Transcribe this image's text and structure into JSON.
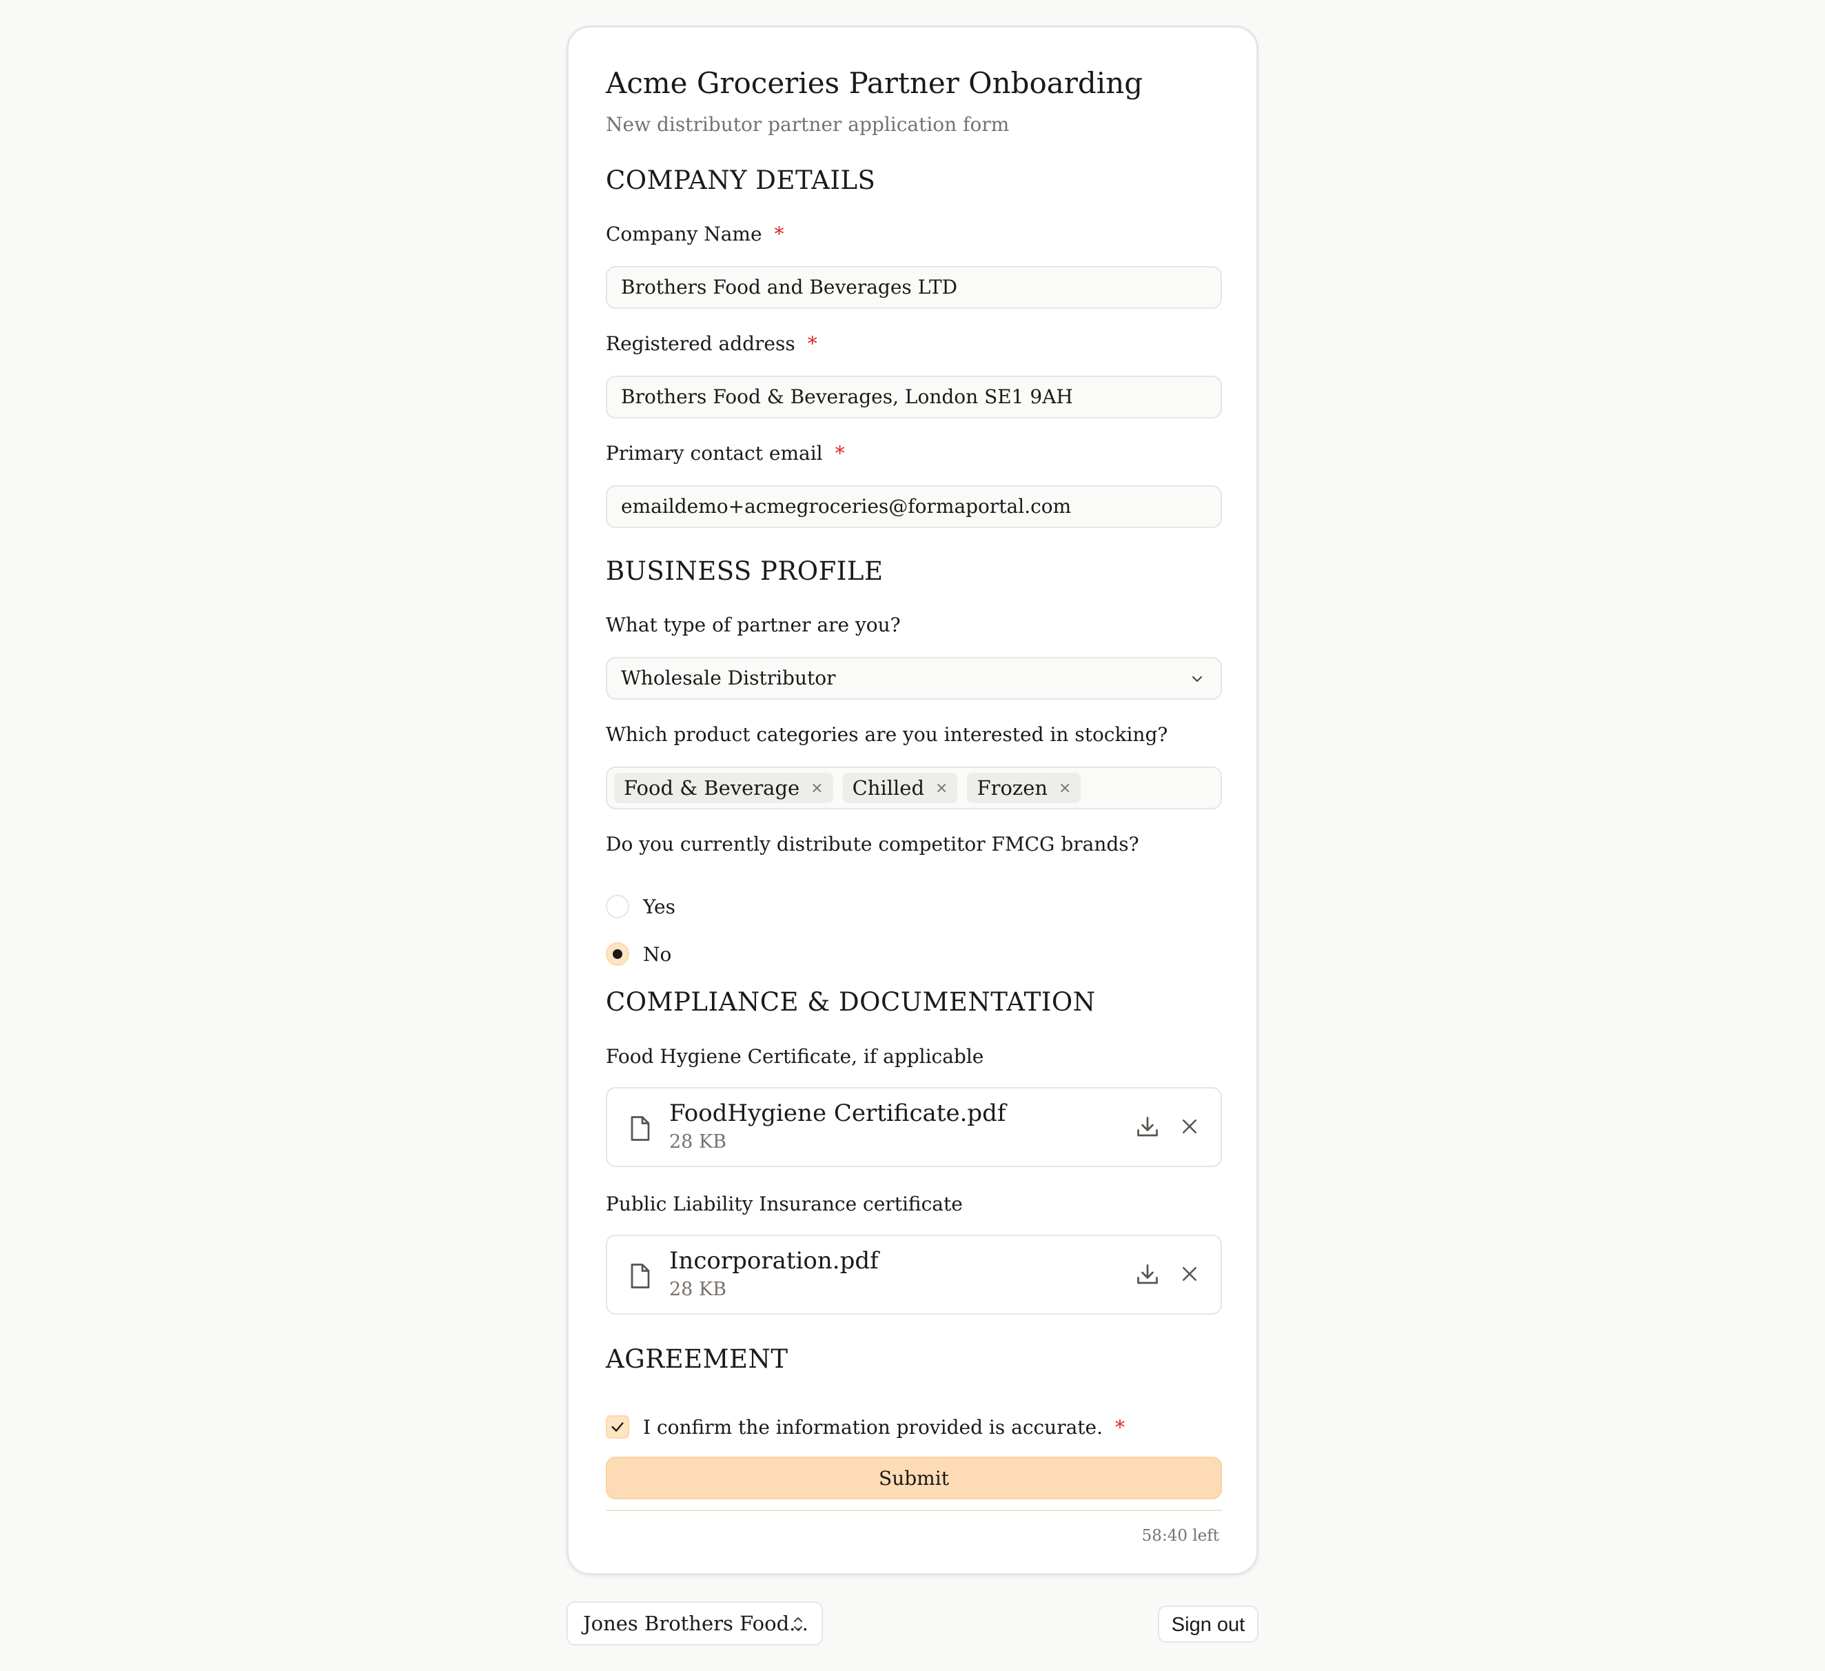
{
  "form": {
    "title": "Acme Groceries Partner Onboarding",
    "subtitle": "New distributor partner application form",
    "required_marker": "*"
  },
  "company_details": {
    "heading": "COMPANY DETAILS",
    "company_name": {
      "label": "Company Name",
      "value": "Brothers Food and Beverages LTD"
    },
    "registered_address": {
      "label": "Registered address",
      "value": "Brothers Food & Beverages, London SE1 9AH"
    },
    "primary_email": {
      "label": "Primary contact email",
      "value": "emaildemo+acmegroceries@formaportal.com"
    }
  },
  "business_profile": {
    "heading": "BUSINESS PROFILE",
    "partner_type": {
      "label": "What type of partner are you?",
      "value": "Wholesale Distributor"
    },
    "categories": {
      "label": "Which product categories are you interested in stocking?",
      "chips": [
        "Food & Beverage",
        "Chilled",
        "Frozen"
      ],
      "remove_glyph": "×"
    },
    "competitor": {
      "label": "Do you currently distribute competitor FMCG brands?",
      "options": [
        "Yes",
        "No"
      ],
      "selected": "No"
    }
  },
  "compliance": {
    "heading": "COMPLIANCE & DOCUMENTATION",
    "hygiene": {
      "label": "Food Hygiene Certificate, if applicable",
      "file_name": "FoodHygiene Certificate.pdf",
      "file_size": "28 KB"
    },
    "insurance": {
      "label": "Public Liability Insurance certificate",
      "file_name": "Incorporation.pdf",
      "file_size": "28 KB"
    }
  },
  "agreement": {
    "heading": "AGREEMENT",
    "confirm_label": "I confirm the information provided is accurate.",
    "checked": true,
    "submit_label": "Submit",
    "timer": "58:40 left"
  },
  "footer": {
    "account_name": "Jones Brothers Food...",
    "sign_out_label": "Sign out"
  },
  "colors": {
    "accent": "#fddcb5",
    "required": "#dc2626",
    "muted_text": "#78716c"
  },
  "icons": {
    "select": "chevron-down-icon",
    "file": "file-icon",
    "download": "download-icon",
    "remove": "close-icon",
    "checkbox": "check-icon",
    "account": "chevron-up-down-icon"
  }
}
